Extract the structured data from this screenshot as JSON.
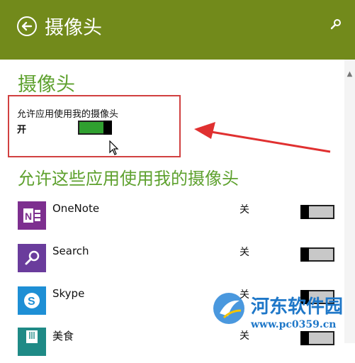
{
  "header": {
    "title": "摄像头",
    "back_icon": "arrow-left-circle-icon",
    "search_icon": "search-icon",
    "background_color": "#728a1b"
  },
  "camera_section": {
    "title": "摄像头",
    "toggle_caption": "允许应用使用我的摄像头",
    "toggle_state_label": "开",
    "toggle_on": true
  },
  "apps_section": {
    "title": "允许这些应用使用我的摄像头",
    "apps": [
      {
        "name": "OneNote",
        "state_label": "关",
        "on": false,
        "icon": "onenote-icon",
        "color": "#7d2f8f"
      },
      {
        "name": "Search",
        "state_label": "关",
        "on": false,
        "icon": "search-app-icon",
        "color": "#6a3c9c"
      },
      {
        "name": "Skype",
        "state_label": "关",
        "on": false,
        "icon": "skype-icon",
        "color": "#1e8fd5"
      },
      {
        "name": "美食",
        "state_label": "关",
        "on": false,
        "icon": "food-icon",
        "color": "#1f8a86"
      }
    ]
  },
  "watermark": {
    "text": "河东软件园",
    "url": "www.pc0359.cn"
  },
  "colors": {
    "accent_green": "#5ea12e",
    "toggle_on": "#30a030",
    "annotation_red": "#d14040"
  }
}
